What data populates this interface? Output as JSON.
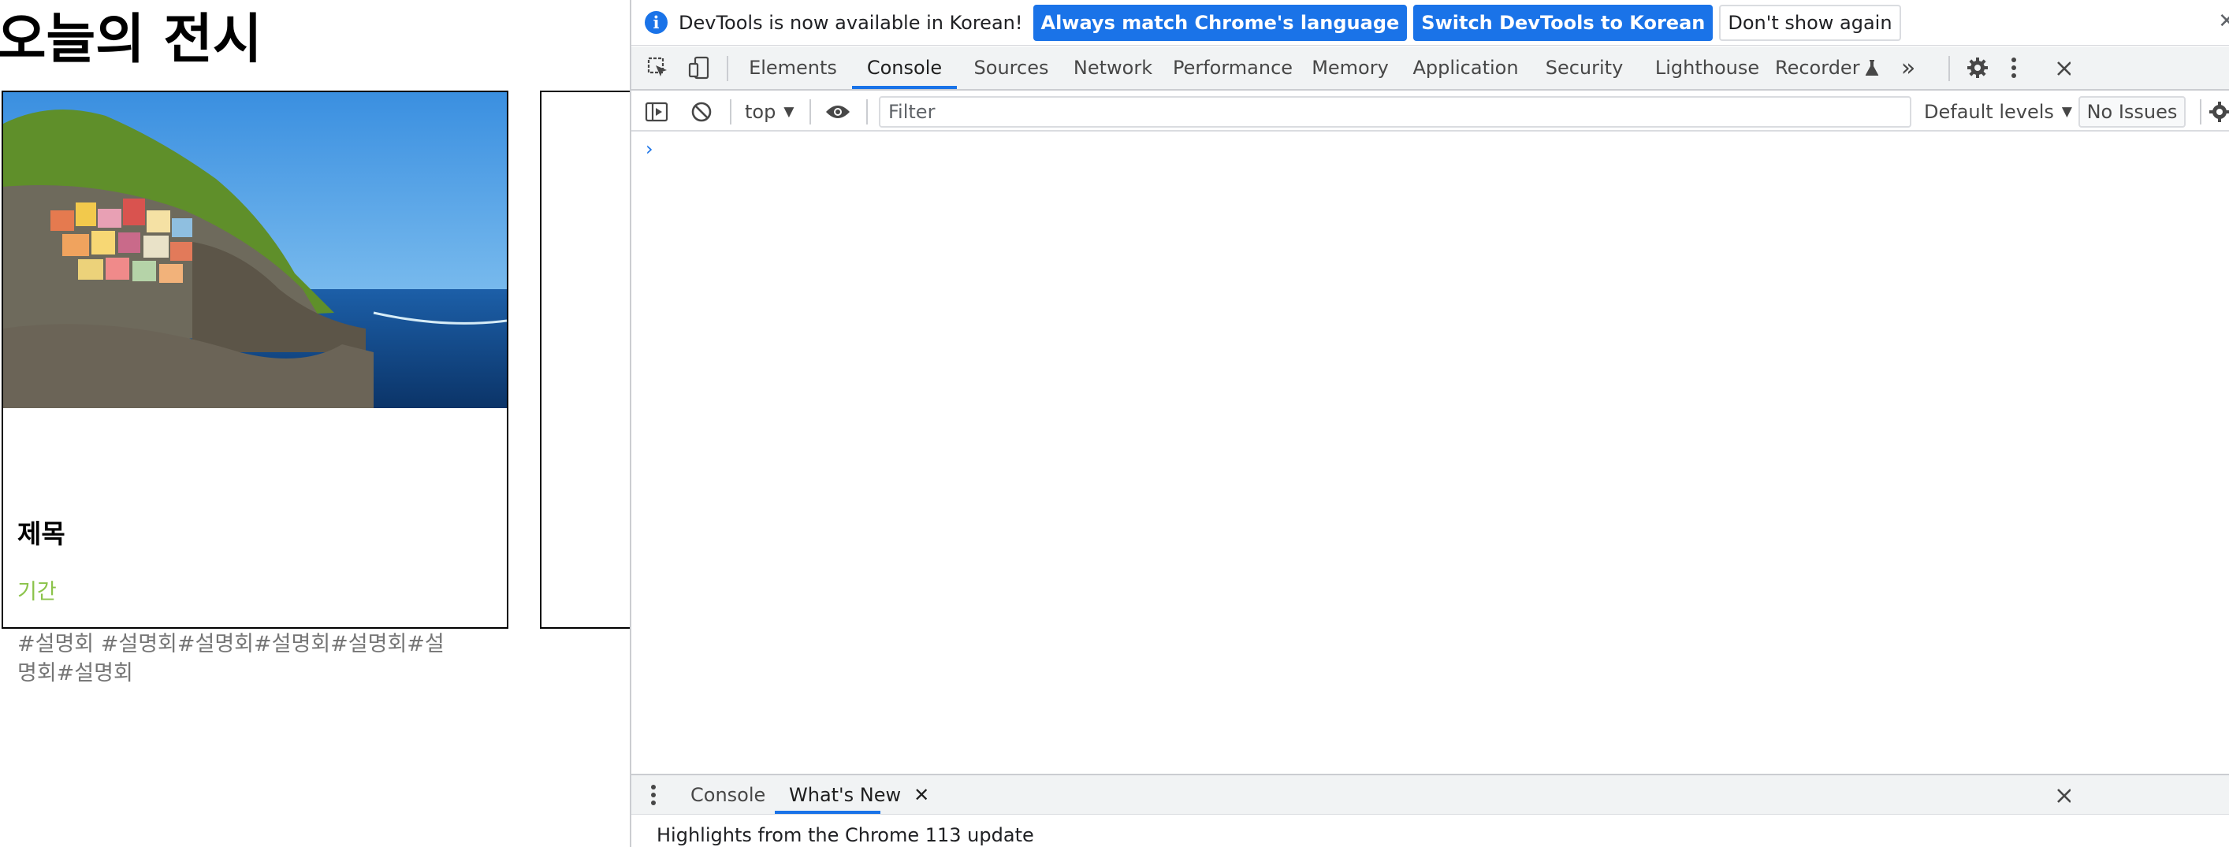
{
  "page": {
    "title": "오늘의 전시",
    "card": {
      "title": "제목",
      "period": "기간",
      "tags": "#설명회 #설명회#설명회#설명회#설명회#설명회#설명회"
    }
  },
  "devtools": {
    "infobar": {
      "message": "DevTools is now available in Korean!",
      "match_button": "Always match Chrome's language",
      "switch_button": "Switch DevTools to Korean",
      "dismiss_button": "Don't show again",
      "close": "✕"
    },
    "tabs": [
      "Elements",
      "Console",
      "Sources",
      "Network",
      "Performance",
      "Memory",
      "Application",
      "Security",
      "Lighthouse",
      "Recorder"
    ],
    "active_tab": "Console",
    "more_tabs": "»",
    "console_toolbar": {
      "context": "top",
      "filter_placeholder": "Filter",
      "levels": "Default levels",
      "issues": "No Issues"
    },
    "prompt": "›",
    "drawer": {
      "tabs": [
        "Console",
        "What's New"
      ],
      "active_tab": "What's New",
      "close_tab": "✕",
      "close_drawer": "✕",
      "headline": "Highlights from the Chrome 113 update"
    },
    "colors": {
      "accent": "#1a73e8",
      "tabbar_bg": "#f1f3f4",
      "period_text": "#8bc34a"
    }
  }
}
